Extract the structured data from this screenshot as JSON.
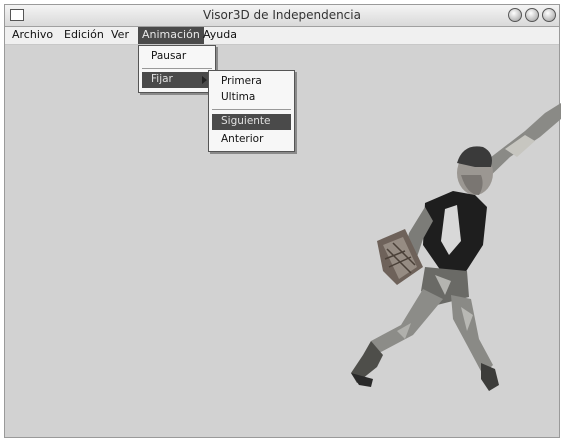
{
  "window": {
    "title": "Visor3D de Independencia",
    "controls": [
      "o",
      "o",
      "o"
    ]
  },
  "menubar": {
    "items": [
      {
        "label": "Archivo"
      },
      {
        "label": "Edición"
      },
      {
        "label": "Ver"
      },
      {
        "label": "Animación",
        "active": true
      },
      {
        "label": "Ayuda"
      }
    ]
  },
  "animation_menu": {
    "items": [
      {
        "label": "Pausar"
      },
      {
        "label": "Fijar",
        "has_submenu": true
      }
    ]
  },
  "fijar_submenu": {
    "items": [
      {
        "label": "Primera"
      },
      {
        "label": "Ultima"
      },
      {
        "label": "Siguiente",
        "highlighted": true
      },
      {
        "label": "Anterior"
      }
    ]
  },
  "viewport": {
    "background_color": "#d2d2d2",
    "figure": "3D textured character mid-stride holding a box"
  }
}
